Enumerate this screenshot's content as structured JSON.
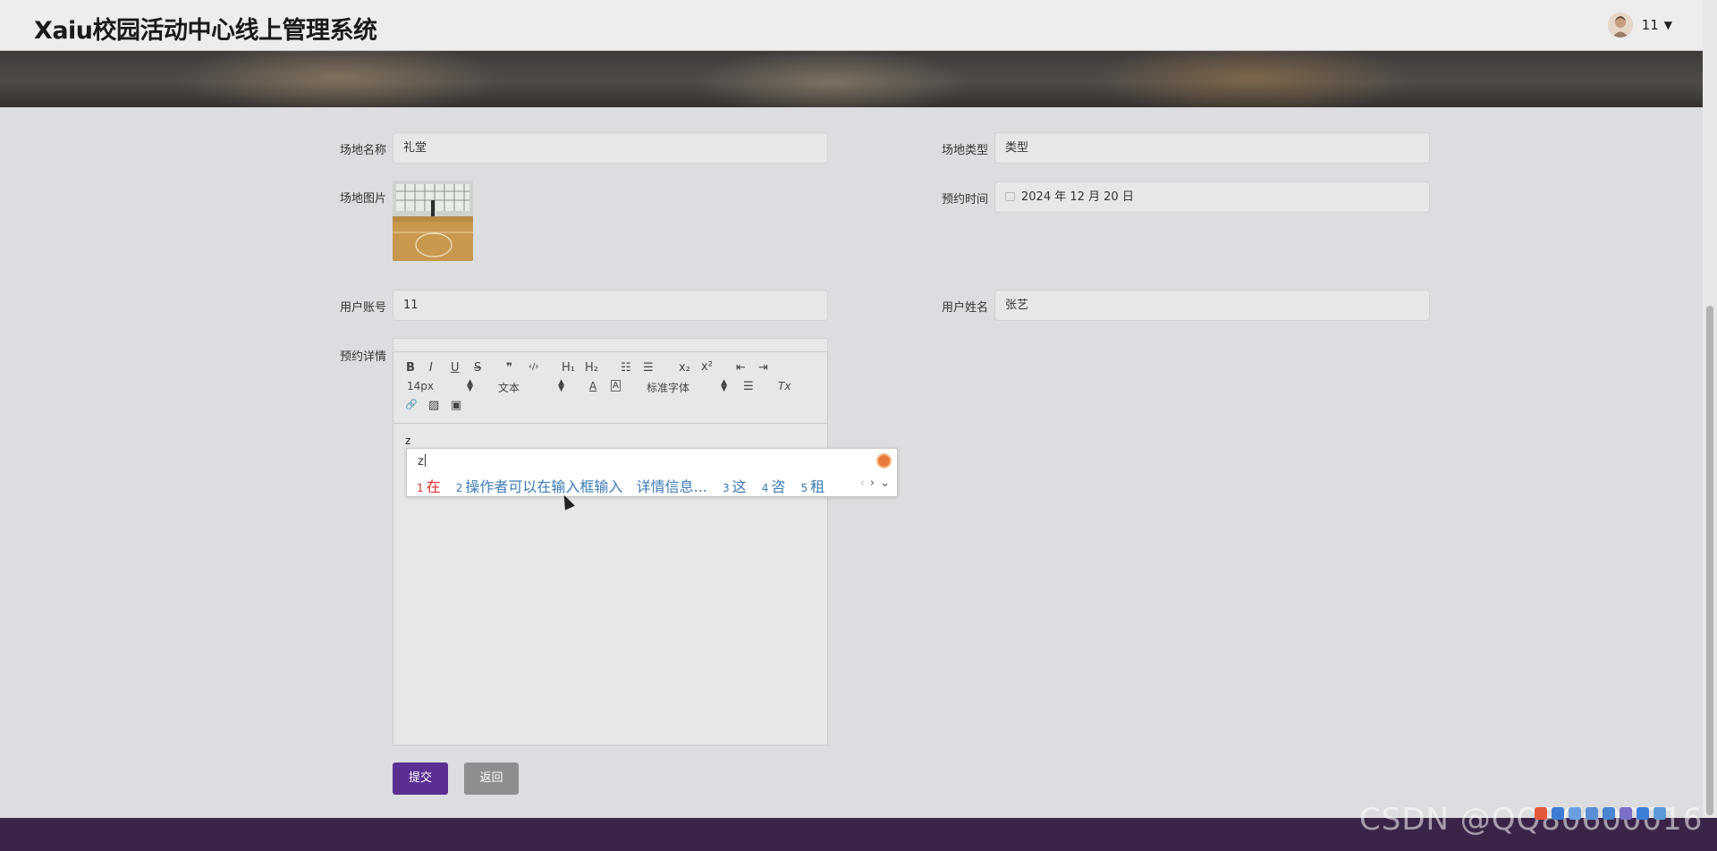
{
  "header": {
    "title": "Xaiu校园活动中心线上管理系统",
    "username": "11",
    "dropdown_icon": "caret-down-icon"
  },
  "form": {
    "venue_name": {
      "label": "场地名称",
      "value": "礼堂"
    },
    "venue_type": {
      "label": "场地类型",
      "value": "类型"
    },
    "venue_image": {
      "label": "场地图片"
    },
    "booking_time": {
      "label": "预约时间",
      "value": "2024 年 12 月 20 日"
    },
    "user_account": {
      "label": "用户账号",
      "value": "11"
    },
    "user_name": {
      "label": "用户姓名",
      "value": "张艺"
    },
    "booking_details": {
      "label": "预约详情",
      "content": "z"
    }
  },
  "editor": {
    "toolbar": {
      "bold": "B",
      "italic": "I",
      "underline": "U",
      "strike": "S",
      "quote": "❞",
      "code": "‹/›",
      "h1": "H₁",
      "h2": "H₂",
      "ordered_list": "☷",
      "bullet_list": "☰",
      "subscript": "x₂",
      "superscript": "x²",
      "outdent": "⇤",
      "indent": "⇥",
      "font_size": "14px",
      "header_select": "文本",
      "font_family": "标准字体",
      "font_color": "A",
      "bg_color": "A",
      "align": "☰",
      "clean": "Tx",
      "link": "🔗",
      "image": "▨",
      "video": "▣"
    }
  },
  "ime": {
    "input": "z",
    "candidates": [
      {
        "num": "1",
        "text": "在"
      },
      {
        "num": "2",
        "text": "操作者可以在输入框输入   详情信息..."
      },
      {
        "num": "3",
        "text": "这"
      },
      {
        "num": "4",
        "text": "咨"
      },
      {
        "num": "5",
        "text": "租"
      }
    ],
    "prev": "‹",
    "next": "›",
    "expand": "⌄"
  },
  "buttons": {
    "submit": "提交",
    "back": "返回"
  },
  "watermark": "CSDN @QQ80600016",
  "colors": {
    "primary": "#5b2e91",
    "secondary_button": "#8e8e8f",
    "footer": "#3a2447",
    "ime_first_candidate": "#d9302c",
    "ime_candidate": "#3b7bb5"
  }
}
